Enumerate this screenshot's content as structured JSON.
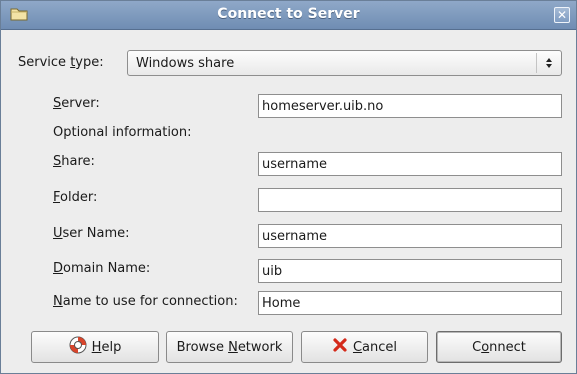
{
  "window": {
    "title": "Connect to Server"
  },
  "service_type": {
    "label_pre": "Service ",
    "label_key": "t",
    "label_post": "ype:",
    "value": "Windows share"
  },
  "form": {
    "server": {
      "label_key": "S",
      "label_rest": "erver:",
      "value": "homeserver.uib.no"
    },
    "optional_heading": "Optional information:",
    "share": {
      "label_key": "S",
      "label_rest": "hare:",
      "value": "username"
    },
    "folder": {
      "label_key": "F",
      "label_rest": "older:",
      "value": ""
    },
    "user_name": {
      "label_key": "U",
      "label_rest": "ser Name:",
      "value": "username"
    },
    "domain_name": {
      "label_key": "D",
      "label_rest": "omain Name:",
      "value": "uib"
    },
    "connection_name": {
      "label_key": "N",
      "label_rest": "ame to use for connection:",
      "value": "Home"
    }
  },
  "buttons": {
    "help": {
      "key": "H",
      "rest": "elp",
      "icon": "lifebuoy-icon"
    },
    "browse": {
      "pre": "Browse ",
      "key": "N",
      "rest": "etwork"
    },
    "cancel": {
      "key": "C",
      "rest": "ancel",
      "icon": "red-x-icon"
    },
    "connect": {
      "pre": "C",
      "key": "o",
      "rest": "nnect"
    }
  },
  "colors": {
    "titlebar": "#7f9bc0",
    "cancel_icon": "#d42a1a",
    "help_icon": "#d8452c"
  }
}
